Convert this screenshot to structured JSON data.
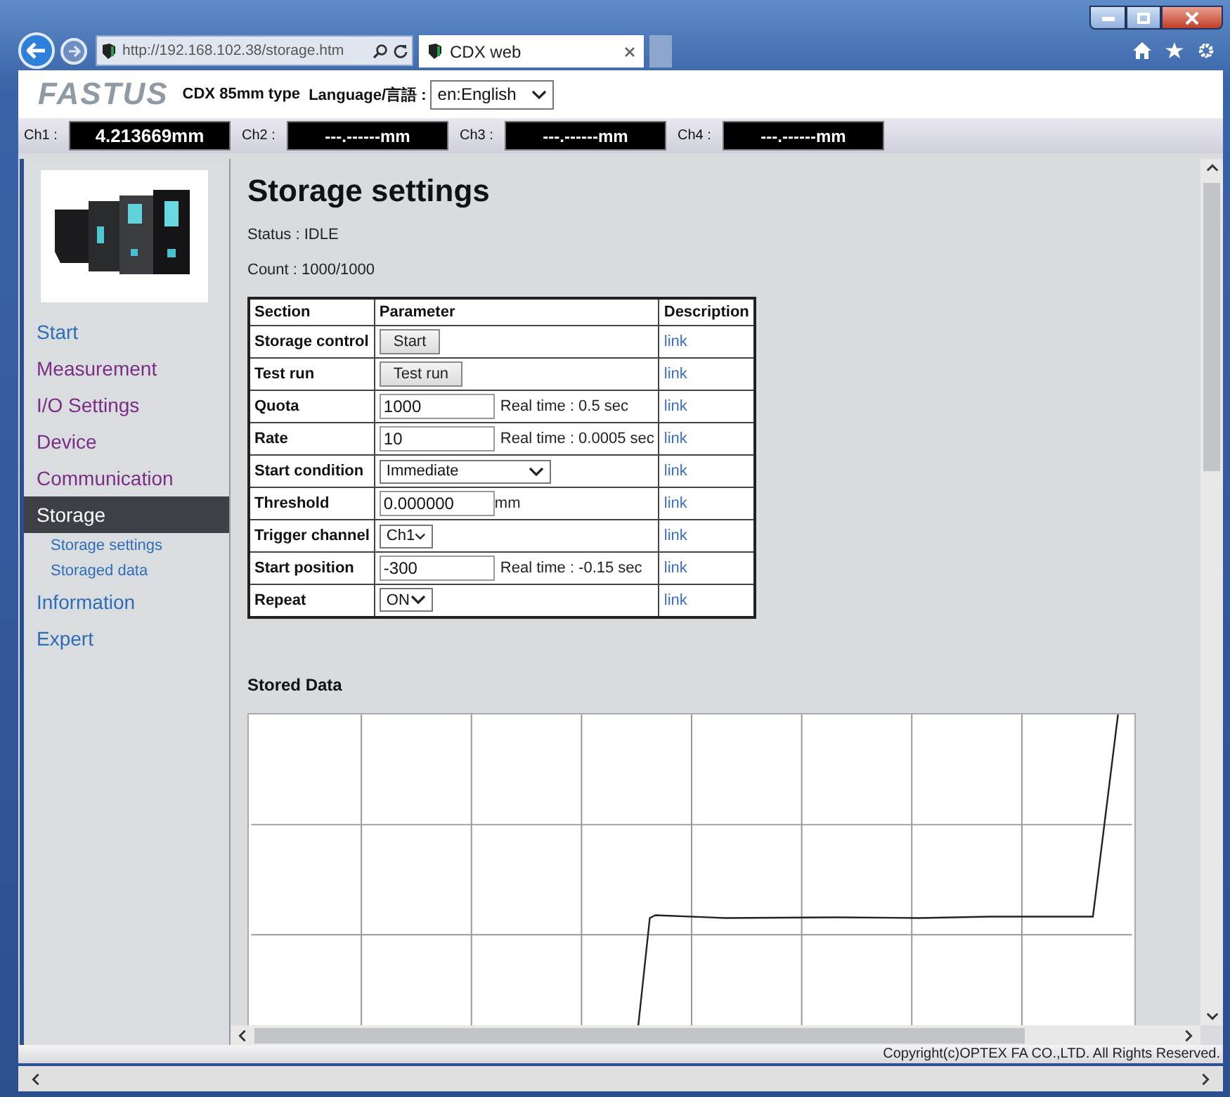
{
  "browser": {
    "address": "http://192.168.102.38/storage.htm",
    "tab_title": "CDX web"
  },
  "header": {
    "logo": "FASTUS",
    "model": "CDX 85mm type",
    "language_label": "Language/言語 :",
    "language": "en:English"
  },
  "channels": [
    {
      "label": "Ch1 :",
      "value": "4.213669mm"
    },
    {
      "label": "Ch2 :",
      "value": "---.------mm"
    },
    {
      "label": "Ch3 :",
      "value": "---.------mm"
    },
    {
      "label": "Ch4 :",
      "value": "---.------mm"
    }
  ],
  "sidebar": {
    "items": [
      {
        "label": "Start",
        "kind": "main",
        "selected": false,
        "visited": false
      },
      {
        "label": "Measurement",
        "kind": "main",
        "selected": false,
        "visited": true
      },
      {
        "label": "I/O Settings",
        "kind": "main",
        "selected": false,
        "visited": true
      },
      {
        "label": "Device",
        "kind": "main",
        "selected": false,
        "visited": true
      },
      {
        "label": "Communication",
        "kind": "main",
        "selected": false,
        "visited": true
      },
      {
        "label": "Storage",
        "kind": "main",
        "selected": true,
        "visited": false
      },
      {
        "label": "Storage settings",
        "kind": "sub",
        "selected": false,
        "visited": false
      },
      {
        "label": "Storaged data",
        "kind": "sub",
        "selected": false,
        "visited": false
      },
      {
        "label": "Information",
        "kind": "main",
        "selected": false,
        "visited": false
      },
      {
        "label": "Expert",
        "kind": "main",
        "selected": false,
        "visited": false
      }
    ]
  },
  "page": {
    "title": "Storage settings",
    "status": "Status : IDLE",
    "count": "Count : 1000/1000",
    "table": {
      "columns": [
        "Section",
        "Parameter",
        "Description"
      ],
      "rows": [
        {
          "section": "Storage control",
          "kind": "button",
          "value": "Start",
          "description": "link"
        },
        {
          "section": "Test run",
          "kind": "button",
          "value": "Test run",
          "description": "link"
        },
        {
          "section": "Quota",
          "kind": "input",
          "value": "1000",
          "note": "Real time : 0.5 sec",
          "description": "link"
        },
        {
          "section": "Rate",
          "kind": "input",
          "value": "10",
          "note": "Real time : 0.0005 sec",
          "description": "link"
        },
        {
          "section": "Start condition",
          "kind": "select",
          "value": "Immediate",
          "wide": true,
          "description": "link"
        },
        {
          "section": "Threshold",
          "kind": "input",
          "value": "0.000000",
          "unit": "mm",
          "description": "link"
        },
        {
          "section": "Trigger channel",
          "kind": "select",
          "value": "Ch1",
          "wide": false,
          "description": "link"
        },
        {
          "section": "Start position",
          "kind": "input",
          "value": "-300",
          "note": "Real time : -0.15 sec",
          "description": "link"
        },
        {
          "section": "Repeat",
          "kind": "select",
          "value": "ON",
          "wide": false,
          "description": "link"
        }
      ]
    },
    "stored_data_title": "Stored Data"
  },
  "copyright": "Copyright(c)OPTEX FA CO.,LTD. All Rights Reserved."
}
